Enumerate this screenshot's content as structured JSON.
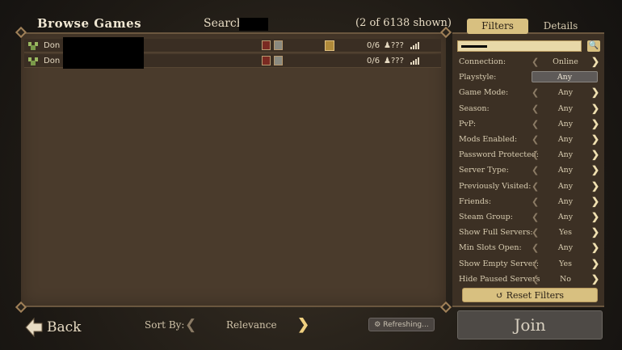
{
  "header": {
    "title": "Browse Games",
    "search_label": "Search:",
    "count_text": "(2 of 6138 shown)"
  },
  "tabs": {
    "filters": "Filters",
    "details": "Details"
  },
  "servers": [
    {
      "name": "Don",
      "players": "0/6",
      "ping": "???"
    },
    {
      "name": "Don",
      "players": "0/6",
      "ping": "???"
    }
  ],
  "filters": [
    {
      "label": "Connection:",
      "value": "Online"
    },
    {
      "label": "Playstyle:",
      "value": "Any"
    },
    {
      "label": "Game Mode:",
      "value": "Any"
    },
    {
      "label": "Season:",
      "value": "Any"
    },
    {
      "label": "PvP:",
      "value": "Any"
    },
    {
      "label": "Mods Enabled:",
      "value": "Any"
    },
    {
      "label": "Password Protected:",
      "value": "Any"
    },
    {
      "label": "Server Type:",
      "value": "Any"
    },
    {
      "label": "Previously Visited:",
      "value": "Any"
    },
    {
      "label": "Friends:",
      "value": "Any"
    },
    {
      "label": "Steam Group:",
      "value": "Any"
    },
    {
      "label": "Show Full Servers:",
      "value": "Yes"
    },
    {
      "label": "Min Slots Open:",
      "value": "Any"
    },
    {
      "label": "Show Empty Server:",
      "value": "Yes"
    },
    {
      "label": "Hide Paused Servers",
      "value": "No"
    }
  ],
  "reset_label": "Reset Filters",
  "footer": {
    "back_label": "Back",
    "sort_label": "Sort By:",
    "sort_value": "Relevance",
    "refresh_label": "Refreshing...",
    "join_label": "Join"
  },
  "colors": {
    "accent": "#d8c080",
    "panel": "#4a3b2c",
    "background": "#2a241c"
  }
}
